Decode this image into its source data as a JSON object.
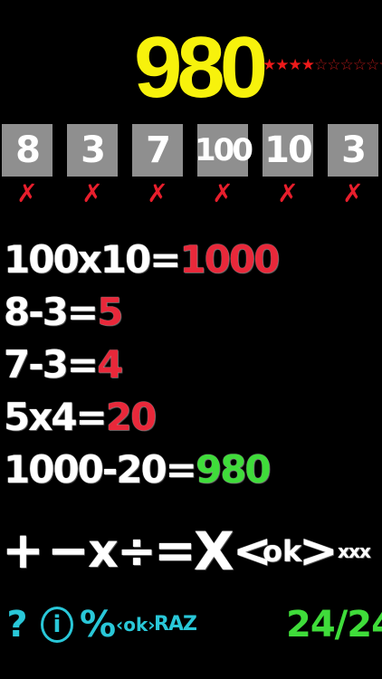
{
  "header": {
    "target": "980",
    "stars": [
      "★",
      "★",
      "★",
      "★",
      "☆",
      "☆",
      "☆",
      "☆",
      "☆",
      "☆"
    ],
    "stars_filled": 4,
    "stars_total": 10
  },
  "tiles": [
    {
      "value": "8",
      "used": true
    },
    {
      "value": "3",
      "used": true
    },
    {
      "value": "7",
      "used": true
    },
    {
      "value": "100",
      "used": true
    },
    {
      "value": "10",
      "used": true
    },
    {
      "value": "3",
      "used": true
    }
  ],
  "used_mark": "✗",
  "equations": [
    {
      "expr": "100x10=",
      "result": "1000",
      "result_color": "red"
    },
    {
      "expr": "8-3=",
      "result": "5",
      "result_color": "red"
    },
    {
      "expr": "7-3=",
      "result": "4",
      "result_color": "red"
    },
    {
      "expr": "5x4=",
      "result": "20",
      "result_color": "red"
    },
    {
      "expr": "1000-20=",
      "result": "980",
      "result_color": "green"
    }
  ],
  "operators": {
    "plus": "+",
    "minus": "−",
    "times": "x",
    "divide": "÷",
    "equals": "=",
    "clear": "X",
    "prev": "<",
    "ok": "ok",
    "next": ">",
    "xxx": "xxx"
  },
  "footer": {
    "help": "?",
    "info": "i",
    "percent": "%",
    "ok": "‹ok›",
    "raz": "RAZ",
    "progress": "24/24"
  },
  "colors": {
    "background": "#000000",
    "target": "#f7f20c",
    "tile": "#8f8f8f",
    "mark": "#e81e2c",
    "result_red": "#e8283a",
    "result_green": "#3fdc3a",
    "footer_cyan": "#29c7d8"
  }
}
